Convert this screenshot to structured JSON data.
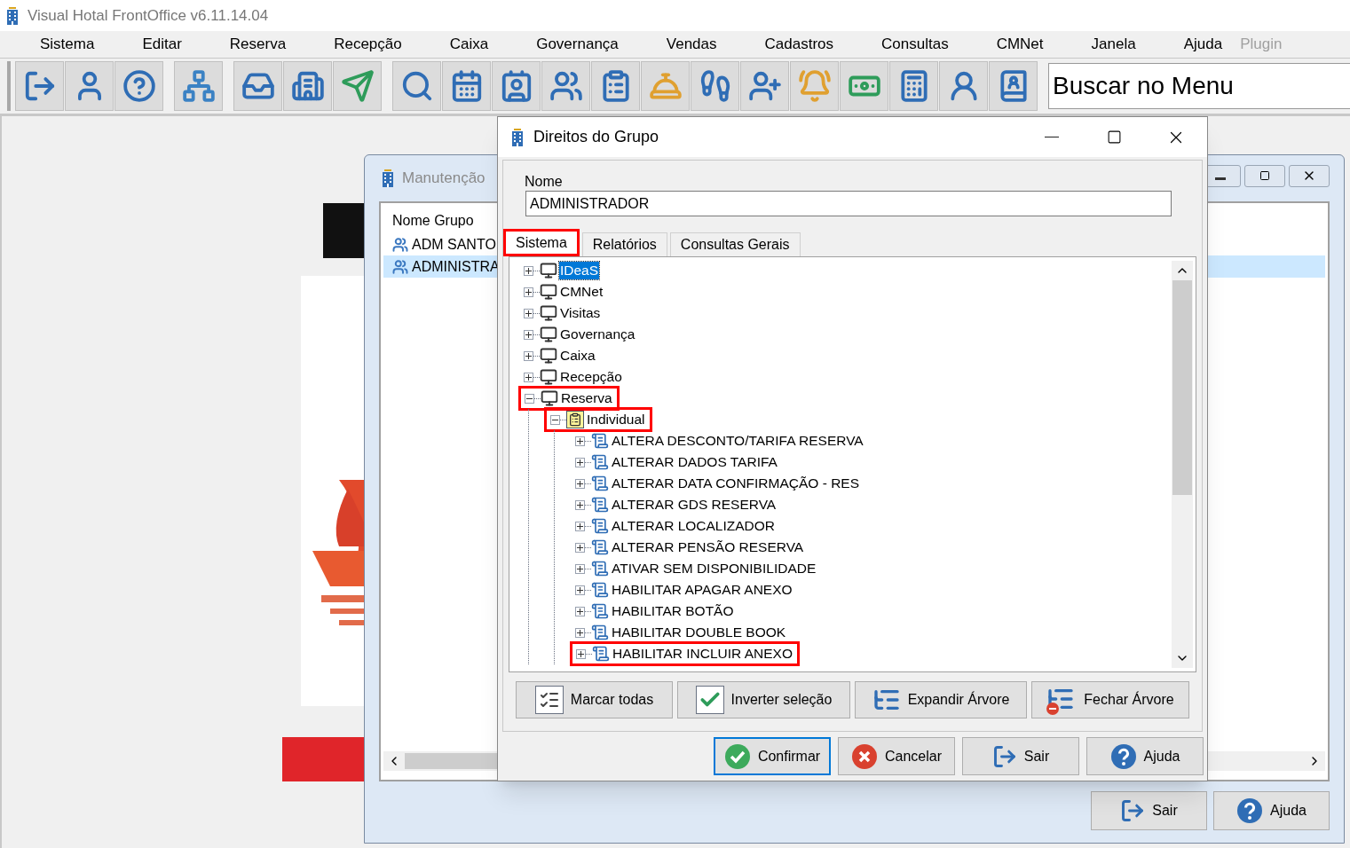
{
  "app": {
    "title": "Visual Hotal FrontOffice v6.11.14.04"
  },
  "menu": [
    {
      "label": "Sistema",
      "disabled": false
    },
    {
      "label": "Editar",
      "disabled": false
    },
    {
      "label": "Reserva",
      "disabled": false
    },
    {
      "label": "Recepção",
      "disabled": false
    },
    {
      "label": "Caixa",
      "disabled": false
    },
    {
      "label": "Governança",
      "disabled": false
    },
    {
      "label": "Vendas",
      "disabled": false
    },
    {
      "label": "Cadastros",
      "disabled": false
    },
    {
      "label": "Consultas",
      "disabled": false
    },
    {
      "label": "CMNet",
      "disabled": false
    },
    {
      "label": "Janela",
      "disabled": false
    },
    {
      "label": "Ajuda",
      "disabled": false
    },
    {
      "label": "Plugin",
      "disabled": true
    }
  ],
  "toolbar": {
    "search": {
      "value": "Buscar no Menu"
    }
  },
  "background_window": {
    "title": "Manutenção",
    "list": {
      "header": "Nome Grupo",
      "rows": [
        {
          "label": "ADM SANTO",
          "selected": false
        },
        {
          "label": "ADMINISTRA",
          "selected": true
        }
      ]
    },
    "buttons": [
      "Sair",
      "Ajuda"
    ]
  },
  "dialog": {
    "title": "Direitos do Grupo",
    "name_label": "Nome",
    "name_value": "ADMINISTRADOR",
    "tabs": [
      {
        "label": "Sistema",
        "selected": true,
        "highlighted": true
      },
      {
        "label": "Relatórios",
        "selected": false,
        "highlighted": false
      },
      {
        "label": "Consultas Gerais",
        "selected": false,
        "highlighted": false
      }
    ],
    "tree": [
      {
        "label": "IDeaS",
        "kind": "module",
        "expanded": false,
        "selected": true,
        "highlighted": false
      },
      {
        "label": "CMNet",
        "kind": "module",
        "expanded": false,
        "selected": false,
        "highlighted": false
      },
      {
        "label": "Visitas",
        "kind": "module",
        "expanded": false,
        "selected": false,
        "highlighted": false
      },
      {
        "label": "Governança",
        "kind": "module",
        "expanded": false,
        "selected": false,
        "highlighted": false
      },
      {
        "label": "Caixa",
        "kind": "module",
        "expanded": false,
        "selected": false,
        "highlighted": false
      },
      {
        "label": "Recepção",
        "kind": "module",
        "expanded": false,
        "selected": false,
        "highlighted": false
      },
      {
        "label": "Reserva",
        "kind": "module",
        "expanded": true,
        "selected": false,
        "highlighted": true,
        "children": [
          {
            "label": "Individual",
            "kind": "group",
            "expanded": true,
            "selected": false,
            "highlighted": true,
            "children": [
              {
                "label": "ALTERA DESCONTO/TARIFA RESERVA",
                "kind": "right",
                "expanded": false,
                "selected": false,
                "highlighted": false
              },
              {
                "label": "ALTERAR DADOS TARIFA",
                "kind": "right",
                "expanded": false,
                "selected": false,
                "highlighted": false
              },
              {
                "label": "ALTERAR DATA CONFIRMAÇÃO - RES",
                "kind": "right",
                "expanded": false,
                "selected": false,
                "highlighted": false
              },
              {
                "label": "ALTERAR GDS RESERVA",
                "kind": "right",
                "expanded": false,
                "selected": false,
                "highlighted": false
              },
              {
                "label": "ALTERAR LOCALIZADOR",
                "kind": "right",
                "expanded": false,
                "selected": false,
                "highlighted": false
              },
              {
                "label": "ALTERAR PENSÃO RESERVA",
                "kind": "right",
                "expanded": false,
                "selected": false,
                "highlighted": false
              },
              {
                "label": "ATIVAR SEM DISPONIBILIDADE",
                "kind": "right",
                "expanded": false,
                "selected": false,
                "highlighted": false
              },
              {
                "label": "HABILITAR APAGAR ANEXO",
                "kind": "right",
                "expanded": false,
                "selected": false,
                "highlighted": false
              },
              {
                "label": "HABILITAR BOTÃO",
                "kind": "right",
                "expanded": false,
                "selected": false,
                "highlighted": false
              },
              {
                "label": "HABILITAR DOUBLE BOOK",
                "kind": "right",
                "expanded": false,
                "selected": false,
                "highlighted": false
              },
              {
                "label": "HABILITAR INCLUIR ANEXO",
                "kind": "right",
                "expanded": false,
                "selected": false,
                "highlighted": true
              }
            ]
          }
        ]
      }
    ],
    "tree_buttons": [
      "Marcar todas",
      "Inverter seleção",
      "Expandir Árvore",
      "Fechar Árvore"
    ],
    "buttons": [
      {
        "label": "Confirmar",
        "focused": true
      },
      {
        "label": "Cancelar",
        "focused": false
      },
      {
        "label": "Sair",
        "focused": false
      },
      {
        "label": "Ajuda",
        "focused": false
      }
    ]
  }
}
